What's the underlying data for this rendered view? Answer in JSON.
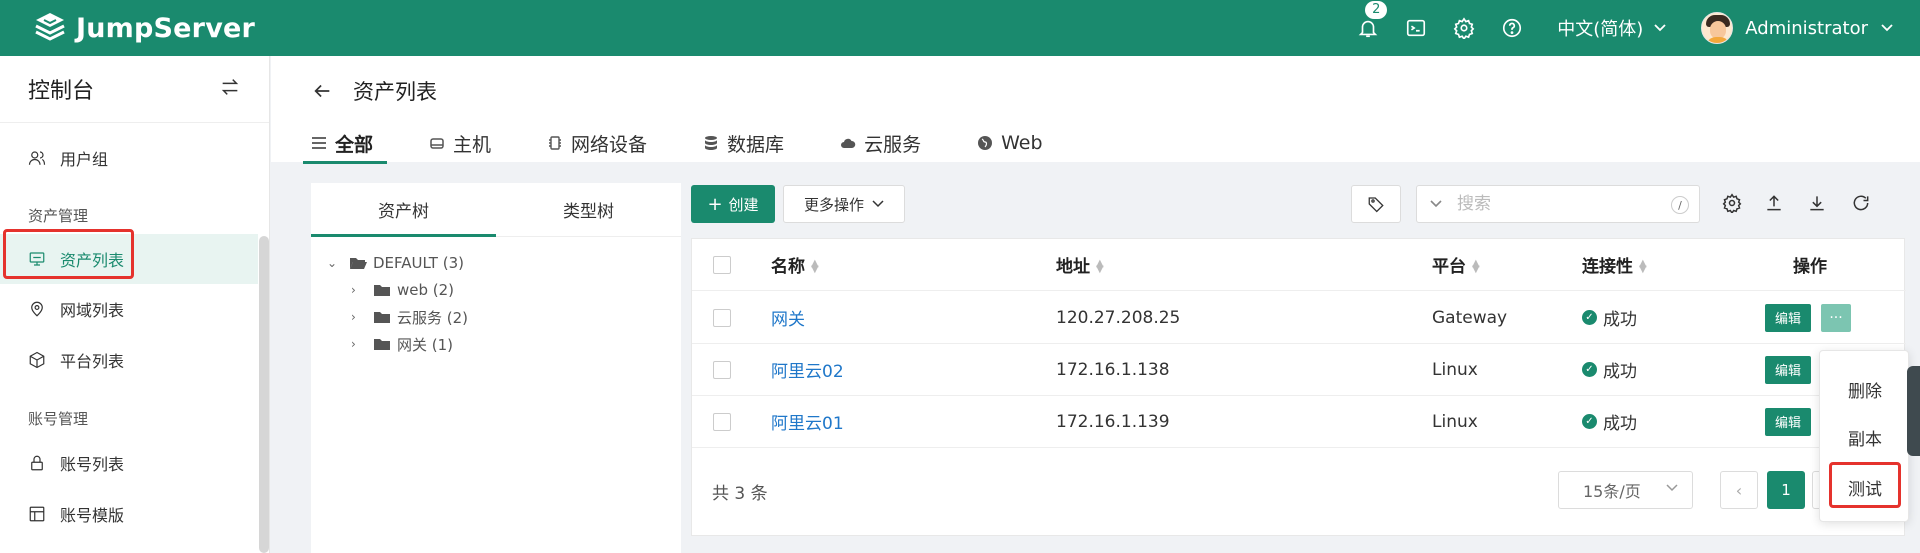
{
  "header": {
    "brand": "JumpServer",
    "notification_count": "2",
    "language": "中文(简体)",
    "username": "Administrator"
  },
  "sidebar": {
    "title": "控制台",
    "items": [
      {
        "label": "用户组",
        "icon": "users-icon"
      },
      {
        "group": "资产管理"
      },
      {
        "label": "资产列表",
        "icon": "monitor-icon",
        "active": true
      },
      {
        "label": "网域列表",
        "icon": "location-icon"
      },
      {
        "label": "平台列表",
        "icon": "cube-icon"
      },
      {
        "group": "账号管理"
      },
      {
        "label": "账号列表",
        "icon": "lock-icon"
      },
      {
        "label": "账号模版",
        "icon": "template-icon"
      }
    ]
  },
  "page": {
    "title": "资产列表",
    "tabs": [
      {
        "label": "全部",
        "icon": "list-icon",
        "active": true
      },
      {
        "label": "主机",
        "icon": "host-icon"
      },
      {
        "label": "网络设备",
        "icon": "chip-icon"
      },
      {
        "label": "数据库",
        "icon": "database-icon"
      },
      {
        "label": "云服务",
        "icon": "cloud-icon"
      },
      {
        "label": "Web",
        "icon": "globe-icon"
      }
    ]
  },
  "tree": {
    "tabs": [
      "资产树",
      "类型树"
    ],
    "root": "DEFAULT (3)",
    "children": [
      "web (2)",
      "云服务 (2)",
      "网关 (1)"
    ]
  },
  "toolbar": {
    "create_label": "创建",
    "more_label": "更多操作",
    "search_placeholder": "搜索",
    "search_shortcut": "/"
  },
  "table": {
    "columns": [
      "名称",
      "地址",
      "平台",
      "连接性",
      "操作"
    ],
    "rows": [
      {
        "name": "网关",
        "address": "120.27.208.25",
        "platform": "Gateway",
        "status": "成功"
      },
      {
        "name": "阿里云02",
        "address": "172.16.1.138",
        "platform": "Linux",
        "status": "成功"
      },
      {
        "name": "阿里云01",
        "address": "172.16.1.139",
        "platform": "Linux",
        "status": "成功"
      }
    ],
    "edit_label": "编辑",
    "more_label": "···",
    "total": "共 3 条",
    "page_size": "15条/页",
    "current_page": "1"
  },
  "dropdown": {
    "items": [
      "删除",
      "副本",
      "测试"
    ]
  },
  "colors": {
    "brand": "#1a8a6e",
    "highlight": "#e5322d",
    "link": "#1f77c9"
  }
}
